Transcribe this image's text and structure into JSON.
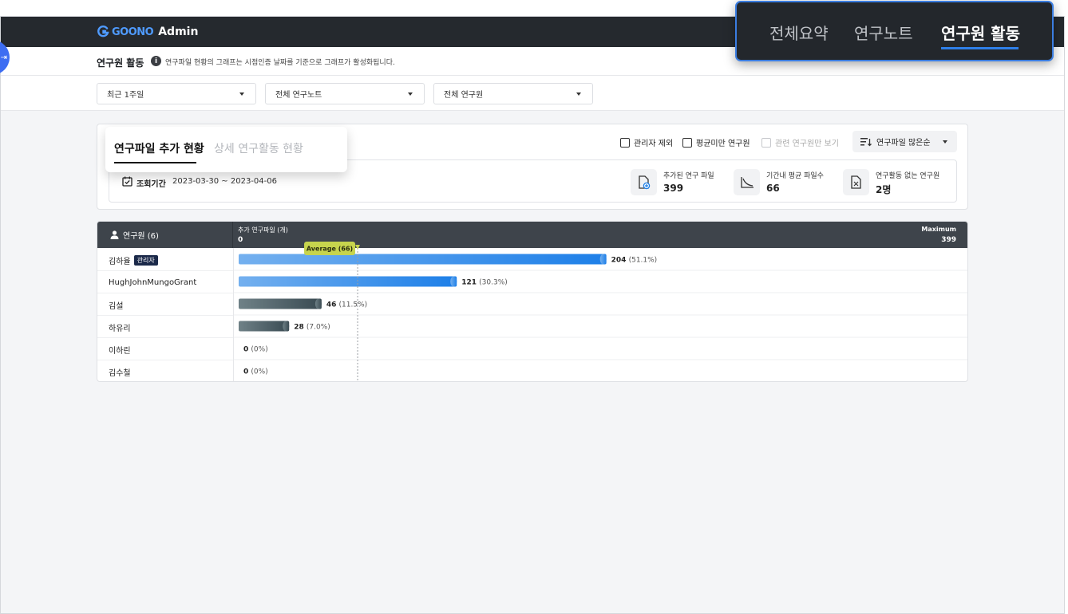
{
  "app": {
    "brand": "GOONO",
    "product": "Admin"
  },
  "nav": {
    "items": [
      {
        "label": "전체요약",
        "active": false
      },
      {
        "label": "연구노트",
        "active": false
      },
      {
        "label": "연구원 활동",
        "active": true
      }
    ]
  },
  "page": {
    "title": "연구원 활동",
    "hint": "연구파일 현황의 그래프는 시점인증 날짜를 기준으로 그래프가 활성화됩니다."
  },
  "filters": {
    "period": "최근 1주일",
    "note": "전체 연구노트",
    "researcher": "전체 연구원"
  },
  "tabs": {
    "active": "연구파일 추가 현황",
    "inactive": "상세 연구활동 현황"
  },
  "options": {
    "exclude_admin": "관리자 제외",
    "below_average": "평균미만 연구원",
    "related_only": "관련 연구원만 보기",
    "sort": "연구파일 많은순"
  },
  "summary": {
    "period_label": "조회기간",
    "period_value": "2023-03-30 ~ 2023-04-06",
    "stats": [
      {
        "label": "추가된 연구 파일",
        "value": "399"
      },
      {
        "label": "기간내 평균 파일수",
        "value": "66"
      },
      {
        "label": "연구활동 없는 연구원",
        "value": "2명"
      }
    ]
  },
  "table": {
    "name_header": "연구원 (6)",
    "axis_label": "추가 연구파일 (개)",
    "axis_min": "0",
    "max_label": "Maximum",
    "max_value": "399",
    "average_label": "Average (66)",
    "admin_badge": "관리자"
  },
  "chart_data": {
    "type": "bar",
    "orientation": "horizontal",
    "xlim": [
      0,
      399
    ],
    "average": 66,
    "categories": [
      "김하율",
      "HughJohnMungoGrant",
      "김설",
      "하유리",
      "이하린",
      "김수철"
    ],
    "values": [
      204,
      121,
      46,
      28,
      0,
      0
    ],
    "percent_labels": [
      "(51.1%)",
      "(30.3%)",
      "(11.5%)",
      "(7.0%)",
      "(0%)",
      "(0%)"
    ],
    "admin_flags": [
      true,
      false,
      false,
      false,
      false,
      false
    ],
    "colors": {
      "highlight_start": "#74b0ef",
      "highlight_end": "#1d7fe8",
      "normal_start": "#6f8187",
      "normal_end": "#394a52",
      "average": "#c7d44d"
    },
    "highlight_count": 2
  }
}
